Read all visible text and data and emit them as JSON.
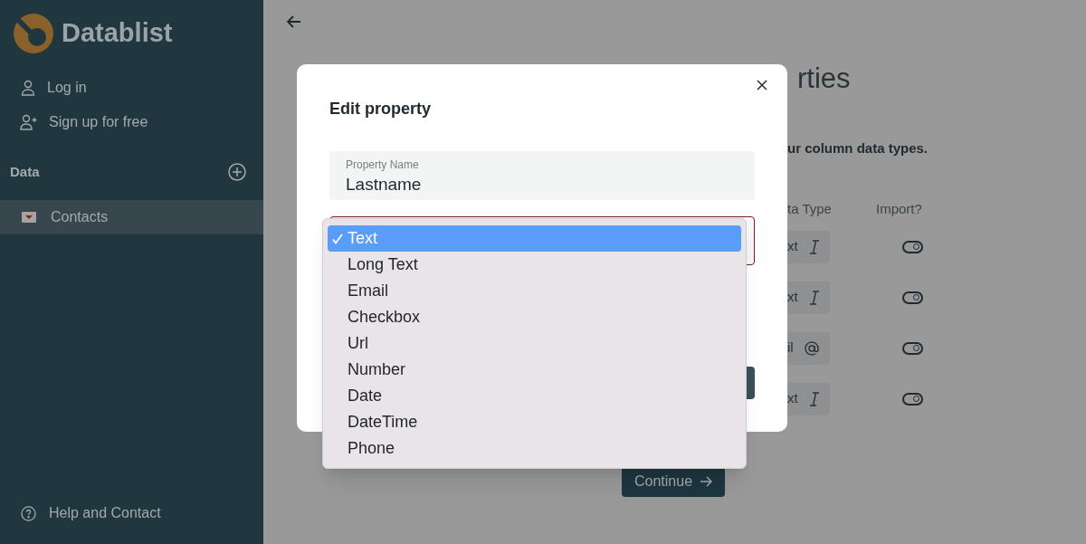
{
  "sidebar": {
    "logo": "Datablist",
    "nav": [
      {
        "label": "Log in",
        "kind": "login"
      },
      {
        "label": "Sign up for free",
        "kind": "signup"
      }
    ],
    "section": "Data",
    "collections": [
      {
        "label": "Contacts",
        "selected": true
      }
    ],
    "footer": "Help and Contact"
  },
  "page": {
    "title": "rties",
    "subtitle": "ur column data types.",
    "columns": [
      "ta Type",
      "Import?"
    ],
    "rows": [
      {
        "type": "xt",
        "kind": "text",
        "import": true
      },
      {
        "type": "xt",
        "kind": "text",
        "import": true
      },
      {
        "type": "il",
        "kind": "email",
        "import": true
      },
      {
        "type": "xt",
        "kind": "text",
        "import": true
      }
    ],
    "continue": "Continue"
  },
  "modal": {
    "title": "Edit property",
    "name_field": {
      "label": "Property Name",
      "value": "Lastname"
    },
    "type_field": {
      "error": true
    },
    "options": [
      {
        "label": "Text",
        "selected": true
      },
      {
        "label": "Long Text",
        "selected": false
      },
      {
        "label": "Email",
        "selected": false
      },
      {
        "label": "Checkbox",
        "selected": false
      },
      {
        "label": "Url",
        "selected": false
      },
      {
        "label": "Number",
        "selected": false
      },
      {
        "label": "Date",
        "selected": false
      },
      {
        "label": "DateTime",
        "selected": false
      },
      {
        "label": "Phone",
        "selected": false
      }
    ]
  }
}
